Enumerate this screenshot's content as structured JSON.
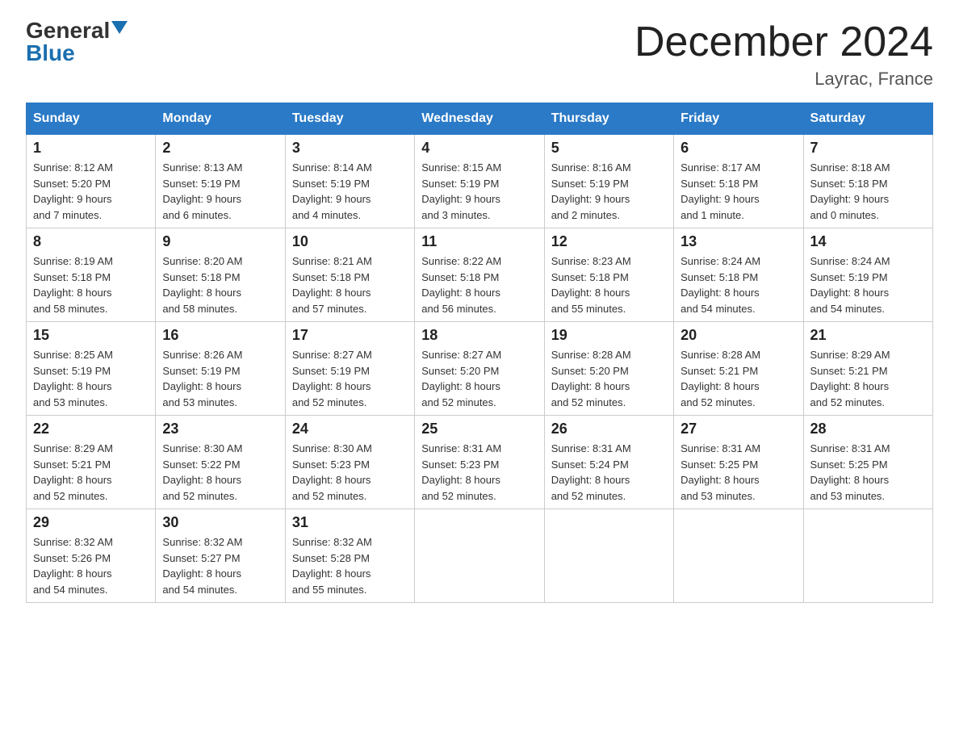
{
  "header": {
    "logo_general": "General",
    "logo_blue": "Blue",
    "month_title": "December 2024",
    "location": "Layrac, France"
  },
  "days_of_week": [
    "Sunday",
    "Monday",
    "Tuesday",
    "Wednesday",
    "Thursday",
    "Friday",
    "Saturday"
  ],
  "weeks": [
    [
      {
        "day": "1",
        "info": "Sunrise: 8:12 AM\nSunset: 5:20 PM\nDaylight: 9 hours\nand 7 minutes."
      },
      {
        "day": "2",
        "info": "Sunrise: 8:13 AM\nSunset: 5:19 PM\nDaylight: 9 hours\nand 6 minutes."
      },
      {
        "day": "3",
        "info": "Sunrise: 8:14 AM\nSunset: 5:19 PM\nDaylight: 9 hours\nand 4 minutes."
      },
      {
        "day": "4",
        "info": "Sunrise: 8:15 AM\nSunset: 5:19 PM\nDaylight: 9 hours\nand 3 minutes."
      },
      {
        "day": "5",
        "info": "Sunrise: 8:16 AM\nSunset: 5:19 PM\nDaylight: 9 hours\nand 2 minutes."
      },
      {
        "day": "6",
        "info": "Sunrise: 8:17 AM\nSunset: 5:18 PM\nDaylight: 9 hours\nand 1 minute."
      },
      {
        "day": "7",
        "info": "Sunrise: 8:18 AM\nSunset: 5:18 PM\nDaylight: 9 hours\nand 0 minutes."
      }
    ],
    [
      {
        "day": "8",
        "info": "Sunrise: 8:19 AM\nSunset: 5:18 PM\nDaylight: 8 hours\nand 58 minutes."
      },
      {
        "day": "9",
        "info": "Sunrise: 8:20 AM\nSunset: 5:18 PM\nDaylight: 8 hours\nand 58 minutes."
      },
      {
        "day": "10",
        "info": "Sunrise: 8:21 AM\nSunset: 5:18 PM\nDaylight: 8 hours\nand 57 minutes."
      },
      {
        "day": "11",
        "info": "Sunrise: 8:22 AM\nSunset: 5:18 PM\nDaylight: 8 hours\nand 56 minutes."
      },
      {
        "day": "12",
        "info": "Sunrise: 8:23 AM\nSunset: 5:18 PM\nDaylight: 8 hours\nand 55 minutes."
      },
      {
        "day": "13",
        "info": "Sunrise: 8:24 AM\nSunset: 5:18 PM\nDaylight: 8 hours\nand 54 minutes."
      },
      {
        "day": "14",
        "info": "Sunrise: 8:24 AM\nSunset: 5:19 PM\nDaylight: 8 hours\nand 54 minutes."
      }
    ],
    [
      {
        "day": "15",
        "info": "Sunrise: 8:25 AM\nSunset: 5:19 PM\nDaylight: 8 hours\nand 53 minutes."
      },
      {
        "day": "16",
        "info": "Sunrise: 8:26 AM\nSunset: 5:19 PM\nDaylight: 8 hours\nand 53 minutes."
      },
      {
        "day": "17",
        "info": "Sunrise: 8:27 AM\nSunset: 5:19 PM\nDaylight: 8 hours\nand 52 minutes."
      },
      {
        "day": "18",
        "info": "Sunrise: 8:27 AM\nSunset: 5:20 PM\nDaylight: 8 hours\nand 52 minutes."
      },
      {
        "day": "19",
        "info": "Sunrise: 8:28 AM\nSunset: 5:20 PM\nDaylight: 8 hours\nand 52 minutes."
      },
      {
        "day": "20",
        "info": "Sunrise: 8:28 AM\nSunset: 5:21 PM\nDaylight: 8 hours\nand 52 minutes."
      },
      {
        "day": "21",
        "info": "Sunrise: 8:29 AM\nSunset: 5:21 PM\nDaylight: 8 hours\nand 52 minutes."
      }
    ],
    [
      {
        "day": "22",
        "info": "Sunrise: 8:29 AM\nSunset: 5:21 PM\nDaylight: 8 hours\nand 52 minutes."
      },
      {
        "day": "23",
        "info": "Sunrise: 8:30 AM\nSunset: 5:22 PM\nDaylight: 8 hours\nand 52 minutes."
      },
      {
        "day": "24",
        "info": "Sunrise: 8:30 AM\nSunset: 5:23 PM\nDaylight: 8 hours\nand 52 minutes."
      },
      {
        "day": "25",
        "info": "Sunrise: 8:31 AM\nSunset: 5:23 PM\nDaylight: 8 hours\nand 52 minutes."
      },
      {
        "day": "26",
        "info": "Sunrise: 8:31 AM\nSunset: 5:24 PM\nDaylight: 8 hours\nand 52 minutes."
      },
      {
        "day": "27",
        "info": "Sunrise: 8:31 AM\nSunset: 5:25 PM\nDaylight: 8 hours\nand 53 minutes."
      },
      {
        "day": "28",
        "info": "Sunrise: 8:31 AM\nSunset: 5:25 PM\nDaylight: 8 hours\nand 53 minutes."
      }
    ],
    [
      {
        "day": "29",
        "info": "Sunrise: 8:32 AM\nSunset: 5:26 PM\nDaylight: 8 hours\nand 54 minutes."
      },
      {
        "day": "30",
        "info": "Sunrise: 8:32 AM\nSunset: 5:27 PM\nDaylight: 8 hours\nand 54 minutes."
      },
      {
        "day": "31",
        "info": "Sunrise: 8:32 AM\nSunset: 5:28 PM\nDaylight: 8 hours\nand 55 minutes."
      },
      null,
      null,
      null,
      null
    ]
  ]
}
